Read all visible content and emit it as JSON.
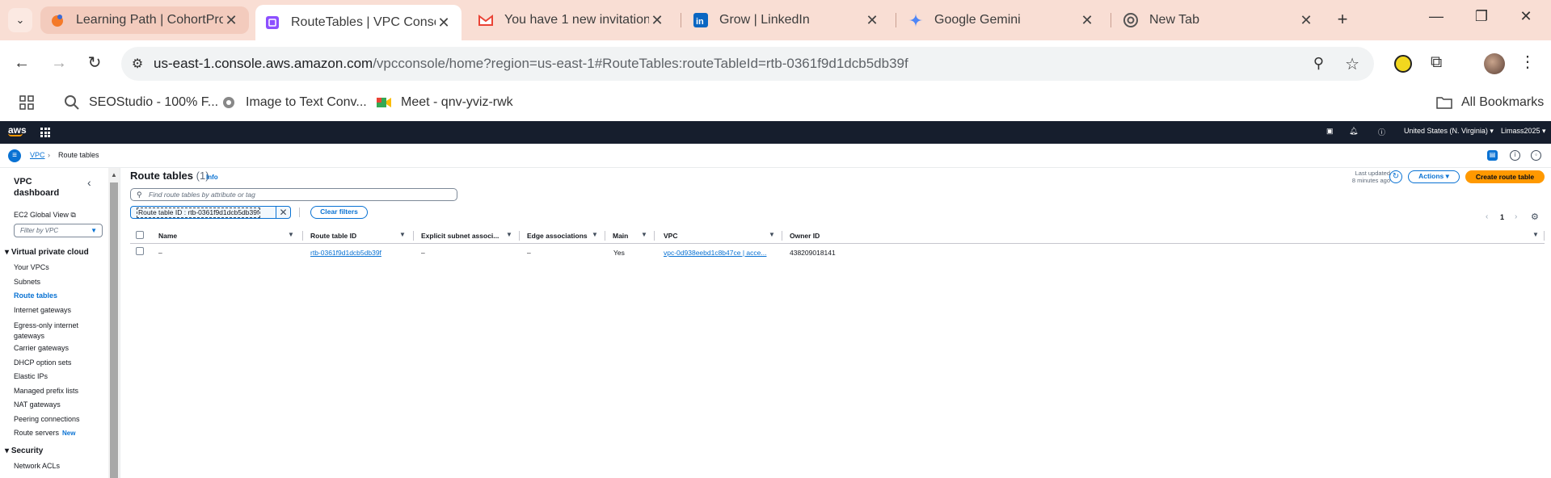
{
  "browser": {
    "tabs": [
      {
        "title": "Learning Path | CohortProj",
        "icon": "cohort-icon"
      },
      {
        "title": "RouteTables | VPC Console",
        "icon": "vpc-icon"
      },
      {
        "title": "You have 1 new invitation",
        "icon": "gmail-icon"
      },
      {
        "title": "Grow | LinkedIn",
        "icon": "linkedin-icon"
      },
      {
        "title": "Google Gemini",
        "icon": "gemini-icon"
      },
      {
        "title": "New Tab",
        "icon": "chrome-icon"
      }
    ],
    "url_host": "us-east-1.console.aws.amazon.com",
    "url_path": "/vpcconsole/home?region=us-east-1#RouteTables:routeTableId=rtb-0361f9d1dcb5db39f",
    "bookmarks": [
      {
        "label": "SEOStudio - 100% F...",
        "icon": "seostudio-icon"
      },
      {
        "label": "Image to Text Conv...",
        "icon": "image-to-text-icon"
      },
      {
        "label": "Meet - qnv-yviz-rwk",
        "icon": "google-meet-icon"
      }
    ],
    "all_bookmarks": "All Bookmarks"
  },
  "aws_header": {
    "logo": "aws",
    "region": "United States (N. Virginia) ▾",
    "account": "Limass2025 ▾"
  },
  "breadcrumb": {
    "root": "VPC",
    "current": "Route tables"
  },
  "sidebar": {
    "title": "VPC dashboard",
    "ec2_global_view": "EC2 Global View",
    "filter_placeholder": "Filter by VPC",
    "section_vpc": "Virtual private cloud",
    "items": [
      {
        "label": "Your VPCs"
      },
      {
        "label": "Subnets"
      },
      {
        "label": "Route tables"
      },
      {
        "label": "Internet gateways"
      },
      {
        "label": "Egress-only internet gateways"
      },
      {
        "label": "Carrier gateways"
      },
      {
        "label": "DHCP option sets"
      },
      {
        "label": "Elastic IPs"
      },
      {
        "label": "Managed prefix lists"
      },
      {
        "label": "NAT gateways"
      },
      {
        "label": "Peering connections"
      },
      {
        "label": "Route servers",
        "badge": "New"
      }
    ],
    "section_security": "Security",
    "security_items": [
      {
        "label": "Network ACLs"
      }
    ]
  },
  "main": {
    "title": "Route tables",
    "count": "(1)",
    "info": "Info",
    "last_updated_1": "Last updated",
    "last_updated_2": "8 minutes ago",
    "actions": "Actions ▾",
    "create": "Create route table",
    "search_placeholder": "Find route tables by attribute or tag",
    "filter_token": "Route table ID : rtb-0361f9d1dcb5db39f",
    "clear_filters": "Clear filters",
    "page": "1",
    "columns": [
      "Name",
      "Route table ID",
      "Explicit subnet associ...",
      "Edge associations",
      "Main",
      "VPC",
      "Owner ID"
    ],
    "rows": [
      {
        "name": "–",
        "route_table_id": "rtb-0361f9d1dcb5db39f",
        "explicit_subnet": "–",
        "edge_associations": "–",
        "main": "Yes",
        "vpc": "vpc-0d938eebd1c8b47ce | acce...",
        "owner_id": "438209018141"
      }
    ]
  },
  "colors": {
    "tabstrip": "#f9ded4",
    "aws_nav": "#161e2d",
    "link_blue": "#0972d3",
    "primary_orange": "#ff9900"
  }
}
